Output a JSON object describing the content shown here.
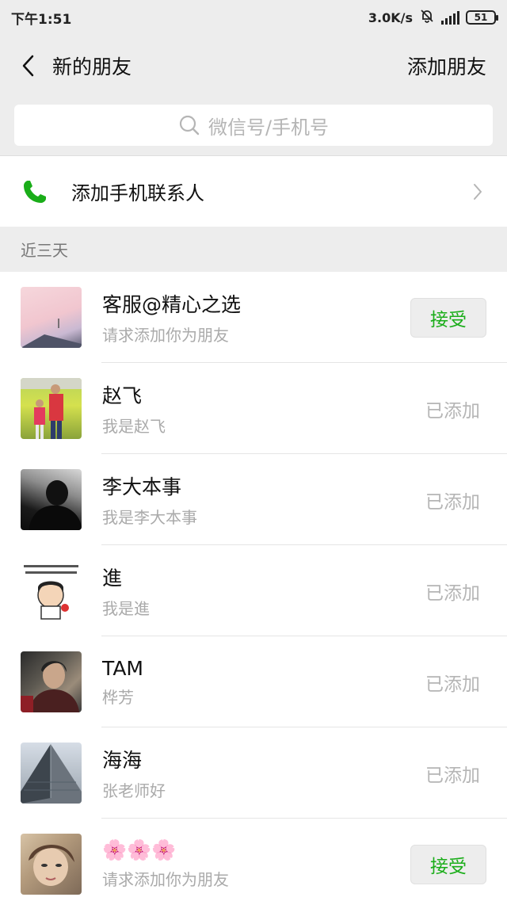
{
  "status_bar": {
    "time": "下午1:51",
    "net_speed": "3.0K/s",
    "network_type": "4G",
    "battery": "51"
  },
  "nav": {
    "title": "新的朋友",
    "action": "添加朋友"
  },
  "search": {
    "placeholder": "微信号/手机号"
  },
  "add_contacts": {
    "label": "添加手机联系人"
  },
  "section": {
    "title": "近三天"
  },
  "friends": [
    {
      "name": "客服@精心之选",
      "message": "请求添加你为朋友",
      "action": "接受",
      "status": "pending"
    },
    {
      "name": "赵飞",
      "message": "我是赵飞",
      "action": "已添加",
      "status": "added"
    },
    {
      "name": "李大本事",
      "message": "我是李大本事",
      "action": "已添加",
      "status": "added"
    },
    {
      "name": "進",
      "message": "我是進",
      "action": "已添加",
      "status": "added"
    },
    {
      "name": "TAM",
      "message": "桦芳",
      "action": "已添加",
      "status": "added"
    },
    {
      "name": "海海",
      "message": "张老师好",
      "action": "已添加",
      "status": "added"
    },
    {
      "name": "🌸🌸🌸",
      "message": "请求添加你为朋友",
      "action": "接受",
      "status": "pending"
    }
  ],
  "colors": {
    "accent": "#1aad19",
    "background": "#ededed",
    "muted": "#aaaaaa"
  },
  "icons": {
    "back": "chevron-left-icon",
    "search": "search-icon",
    "phone": "phone-icon",
    "chevron": "chevron-right-icon"
  }
}
